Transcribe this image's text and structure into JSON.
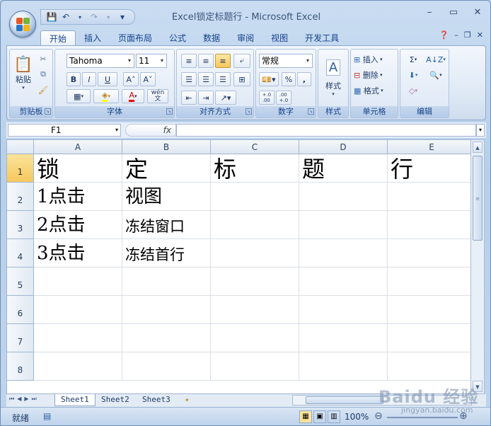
{
  "window": {
    "title": "Excel锁定标题行 - Microsoft Excel",
    "controls": [
      "–",
      "▭",
      "✕"
    ]
  },
  "qat": {
    "save_icon": "💾",
    "undo_icon": "↶",
    "redo_icon": "↷",
    "more_icon": "▾"
  },
  "tabs": [
    "开始",
    "插入",
    "页面布局",
    "公式",
    "数据",
    "审阅",
    "视图",
    "开发工具"
  ],
  "ribbon": {
    "clipboard": {
      "label": "剪贴板",
      "paste": "粘贴"
    },
    "font": {
      "label": "字体",
      "name": "Tahoma",
      "size": "11",
      "bold": "B",
      "italic": "I",
      "underline": "U",
      "grow": "A˄",
      "shrink": "A˅",
      "phonetic": "wén\n文"
    },
    "alignment": {
      "label": "对齐方式"
    },
    "number": {
      "label": "数字",
      "format": "常规",
      "percent": "%",
      "comma": ",",
      "inc_decimal": "+.0\n.00",
      "dec_decimal": ".00\n+.0"
    },
    "styles": {
      "label": "样式",
      "button": "样式"
    },
    "cells": {
      "label": "单元格",
      "insert": "插入",
      "delete": "删除",
      "format": "格式"
    },
    "editing": {
      "label": "编辑",
      "sum": "Σ",
      "sort": "A↓Z",
      "fill": "⬇",
      "find": "🔍",
      "clear": "◇"
    }
  },
  "formula_bar": {
    "name_box": "F1",
    "fx": "fx",
    "content": ""
  },
  "sheet": {
    "columns": [
      "A",
      "B",
      "C",
      "D",
      "E"
    ],
    "rows": [
      "1",
      "2",
      "3",
      "4",
      "5",
      "6",
      "7",
      "8"
    ],
    "cells": {
      "A1": "锁",
      "B1": "定",
      "C1": "标",
      "D1": "题",
      "E1": "行",
      "A2": "1点击",
      "B2": "视图",
      "A3": "2点击",
      "B3": "冻结窗口",
      "A4": "3点击",
      "B4": "冻结首行"
    }
  },
  "sheet_tabs": [
    "Sheet1",
    "Sheet2",
    "Sheet3"
  ],
  "status": {
    "ready": "就绪",
    "zoom": "100%"
  },
  "watermark": {
    "brand": "Baidu 经验",
    "url": "jingyan.baidu.com"
  },
  "colors": {
    "accent": "#15428b",
    "selected_row_header": "#f6c85f"
  }
}
